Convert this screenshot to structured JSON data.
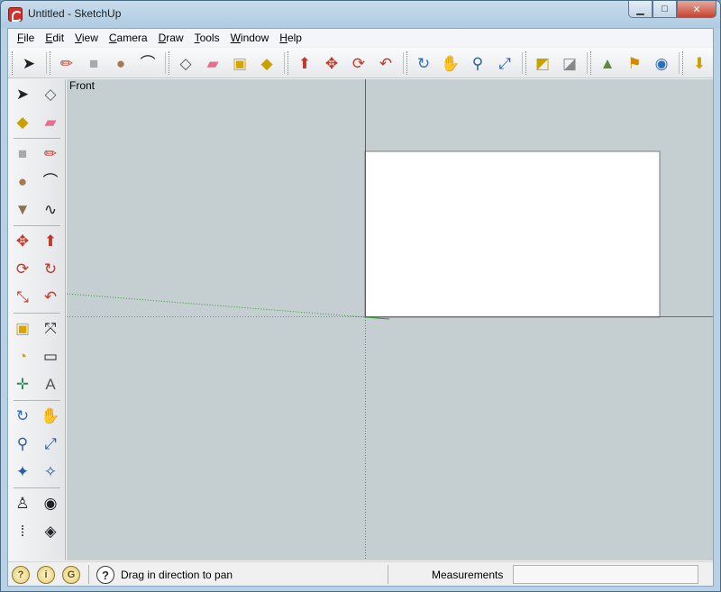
{
  "window": {
    "title": "Untitled - SketchUp",
    "minimize_label": "▁",
    "maximize_label": "□",
    "close_label": "✕"
  },
  "menu": [
    {
      "label": "File",
      "key": "F",
      "rest": "ile"
    },
    {
      "label": "Edit",
      "key": "E",
      "rest": "dit"
    },
    {
      "label": "View",
      "key": "V",
      "rest": "iew"
    },
    {
      "label": "Camera",
      "key": "C",
      "rest": "amera"
    },
    {
      "label": "Draw",
      "key": "D",
      "rest": "raw"
    },
    {
      "label": "Tools",
      "key": "T",
      "rest": "ools"
    },
    {
      "label": "Window",
      "key": "W",
      "rest": "indow"
    },
    {
      "label": "Help",
      "key": "H",
      "rest": "elp"
    }
  ],
  "top_toolbar": [
    {
      "name": "select-icon",
      "glyph": "➤",
      "color": "#222222"
    },
    {
      "name": "pencil-icon",
      "glyph": "✏",
      "color": "#c0392b"
    },
    {
      "name": "rectangle-icon",
      "glyph": "■",
      "color": "#a9a9a9"
    },
    {
      "name": "circle-icon",
      "glyph": "●",
      "color": "#a27c4f"
    },
    {
      "name": "arc-icon",
      "glyph": "⌒",
      "color": "#222222"
    },
    {
      "name": "make-component-icon",
      "glyph": "◇",
      "color": "#555555"
    },
    {
      "name": "eraser-icon",
      "glyph": "▰",
      "color": "#e3708e"
    },
    {
      "name": "tape-measure-icon",
      "glyph": "▣",
      "color": "#d9a400"
    },
    {
      "name": "paint-bucket-icon",
      "glyph": "◆",
      "color": "#c9a100"
    },
    {
      "name": "push-pull-icon",
      "glyph": "⬆",
      "color": "#c0392b"
    },
    {
      "name": "move-icon",
      "glyph": "✥",
      "color": "#c0392b"
    },
    {
      "name": "rotate-icon",
      "glyph": "⟳",
      "color": "#c0392b"
    },
    {
      "name": "offset-icon",
      "glyph": "↶",
      "color": "#c0392b"
    },
    {
      "name": "orbit-icon",
      "glyph": "↻",
      "color": "#2e6fba"
    },
    {
      "name": "pan-icon",
      "glyph": "✋",
      "color": "#333333"
    },
    {
      "name": "zoom-icon",
      "glyph": "⚲",
      "color": "#2b5d9b"
    },
    {
      "name": "zoom-extents-icon",
      "glyph": "⤢",
      "color": "#2b5d9b"
    },
    {
      "name": "previous-view-icon",
      "glyph": "◩",
      "color": "#c9a100"
    },
    {
      "name": "next-view-icon",
      "glyph": "◪",
      "color": "#888888"
    },
    {
      "name": "add-location-icon",
      "glyph": "▲",
      "color": "#5a8a3a"
    },
    {
      "name": "toggle-terrain-icon",
      "glyph": "⚑",
      "color": "#d08a00"
    },
    {
      "name": "google-earth-icon",
      "glyph": "◉",
      "color": "#2e6fba"
    },
    {
      "name": "get-models-icon",
      "glyph": "⬇",
      "color": "#c9a100"
    },
    {
      "name": "share-model-icon",
      "glyph": "⬆",
      "color": "#c9a100"
    }
  ],
  "left_toolbar": [
    {
      "name": "select-icon",
      "glyph": "➤",
      "color": "#222222"
    },
    {
      "name": "make-component-icon",
      "glyph": "◇",
      "color": "#666666"
    },
    {
      "name": "paint-bucket-icon",
      "glyph": "◆",
      "color": "#c9a100"
    },
    {
      "name": "eraser-icon",
      "glyph": "▰",
      "color": "#e3708e"
    },
    {
      "name": "rectangle-icon",
      "glyph": "■",
      "color": "#a9a9a9"
    },
    {
      "name": "line-icon",
      "glyph": "✏",
      "color": "#c0392b"
    },
    {
      "name": "circle-icon",
      "glyph": "●",
      "color": "#a27c4f"
    },
    {
      "name": "arc-icon",
      "glyph": "⌒",
      "color": "#222222"
    },
    {
      "name": "polygon-icon",
      "glyph": "▼",
      "color": "#8b7355"
    },
    {
      "name": "freehand-icon",
      "glyph": "∿",
      "color": "#222222"
    },
    {
      "name": "move-icon",
      "glyph": "✥",
      "color": "#c0392b"
    },
    {
      "name": "push-pull-icon",
      "glyph": "⬆",
      "color": "#c0392b"
    },
    {
      "name": "rotate-icon",
      "glyph": "⟳",
      "color": "#c0392b"
    },
    {
      "name": "follow-me-icon",
      "glyph": "↻",
      "color": "#c0392b"
    },
    {
      "name": "scale-icon",
      "glyph": "⤡",
      "color": "#c0392b"
    },
    {
      "name": "offset-icon",
      "glyph": "↶",
      "color": "#c0392b"
    },
    {
      "name": "tape-measure-icon",
      "glyph": "▣",
      "color": "#d9a400"
    },
    {
      "name": "dimension-icon",
      "glyph": "⤧",
      "color": "#222222"
    },
    {
      "name": "protractor-icon",
      "glyph": "◔",
      "color": "#d9a400"
    },
    {
      "name": "text-icon",
      "glyph": "▭",
      "color": "#222222"
    },
    {
      "name": "axes-icon",
      "glyph": "✛",
      "color": "#2e8b57"
    },
    {
      "name": "3d-text-icon",
      "glyph": "A",
      "color": "#555555"
    },
    {
      "name": "orbit-icon",
      "glyph": "↻",
      "color": "#2e6fba"
    },
    {
      "name": "pan-icon",
      "glyph": "✋",
      "color": "#333333"
    },
    {
      "name": "zoom-icon",
      "glyph": "⚲",
      "color": "#2b5d9b"
    },
    {
      "name": "zoom-window-icon",
      "glyph": "⤢",
      "color": "#2b5d9b"
    },
    {
      "name": "zoom-extents-icon",
      "glyph": "✦",
      "color": "#2b5d9b"
    },
    {
      "name": "previous-icon",
      "glyph": "✧",
      "color": "#2b5d9b"
    },
    {
      "name": "position-camera-icon",
      "glyph": "♙",
      "color": "#222222"
    },
    {
      "name": "look-around-icon",
      "glyph": "◉",
      "color": "#222222"
    },
    {
      "name": "walk-icon",
      "glyph": "⁞",
      "color": "#222222"
    },
    {
      "name": "section-plane-icon",
      "glyph": "◈",
      "color": "#222222"
    }
  ],
  "viewport": {
    "view_name": "Front",
    "background_color": "#c5cfd1",
    "face_color": "#ffffff",
    "red_axis_color": "#c34a4a",
    "green_axis_color": "#2e9b2e",
    "blue_axis_color": "#4a55c8"
  },
  "statusbar": {
    "icons": [
      "geo-location-icon",
      "credits-icon",
      "user-icon"
    ],
    "icon_glyphs": [
      "?",
      "i",
      "G"
    ],
    "help_glyph": "?",
    "message": "Drag in direction to pan",
    "measurements_label": "Measurements",
    "measurements_value": ""
  }
}
